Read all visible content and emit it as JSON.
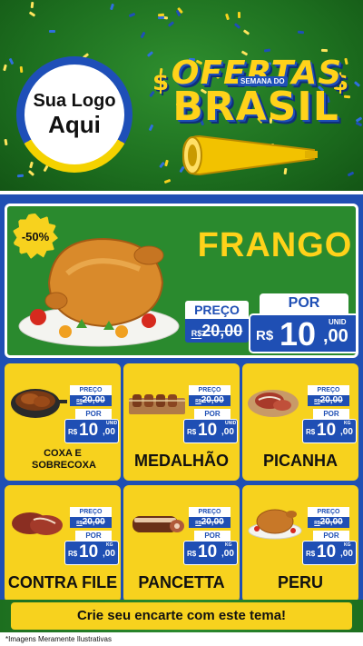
{
  "header": {
    "logo_line1": "Sua Logo",
    "logo_line2": "Aqui",
    "title_top": "OFERTAS",
    "title_small": "SEMANA DO",
    "title_bottom": "BRASIL",
    "dollar": "$"
  },
  "hero": {
    "badge": "-50%",
    "name": "FRANGO",
    "preco_label": "PREÇO",
    "old_currency": "R$",
    "old_price": "20,00",
    "por_label": "POR",
    "currency": "R$",
    "price_int": "10",
    "price_dec": ",00",
    "unit": "UNID",
    "image_icon": "roast-chicken-icon"
  },
  "products": [
    {
      "name": "COXA E SOBRECOXA",
      "preco_label": "PREÇO",
      "old_currency": "R$",
      "old_price": "20,00",
      "por_label": "POR",
      "currency": "R$",
      "price_int": "10",
      "price_dec": ",00",
      "unit": "UNID",
      "image_icon": "chicken-pan-icon"
    },
    {
      "name": "MEDALHÃO",
      "preco_label": "PREÇO",
      "old_currency": "R$",
      "old_price": "20,00",
      "por_label": "POR",
      "currency": "R$",
      "price_int": "10",
      "price_dec": ",00",
      "unit": "UNID",
      "image_icon": "skewers-icon"
    },
    {
      "name": "PICANHA",
      "preco_label": "PREÇO",
      "old_currency": "R$",
      "old_price": "20,00",
      "por_label": "POR",
      "currency": "R$",
      "price_int": "10",
      "price_dec": ",00",
      "unit": "KG",
      "image_icon": "steak-board-icon"
    },
    {
      "name": "CONTRA FILE",
      "preco_label": "PREÇO",
      "old_currency": "R$",
      "old_price": "20,00",
      "por_label": "POR",
      "currency": "R$",
      "price_int": "10",
      "price_dec": ",00",
      "unit": "KG",
      "image_icon": "beef-steaks-icon"
    },
    {
      "name": "PANCETTA",
      "preco_label": "PREÇO",
      "old_currency": "R$",
      "old_price": "20,00",
      "por_label": "POR",
      "currency": "R$",
      "price_int": "10",
      "price_dec": ",00",
      "unit": "KG",
      "image_icon": "pancetta-icon"
    },
    {
      "name": "PERU",
      "preco_label": "PREÇO",
      "old_currency": "R$",
      "old_price": "20,00",
      "por_label": "POR",
      "currency": "R$",
      "price_int": "10",
      "price_dec": ",00",
      "unit": "KG",
      "image_icon": "roast-turkey-icon"
    }
  ],
  "footer": {
    "cta": "Crie seu encarte com este tema!",
    "disclaimer": "*Imagens Meramente Ilustrativas"
  },
  "colors": {
    "green": "#2a8a2e",
    "blue": "#1f4fb4",
    "yellow": "#f7d21e"
  }
}
